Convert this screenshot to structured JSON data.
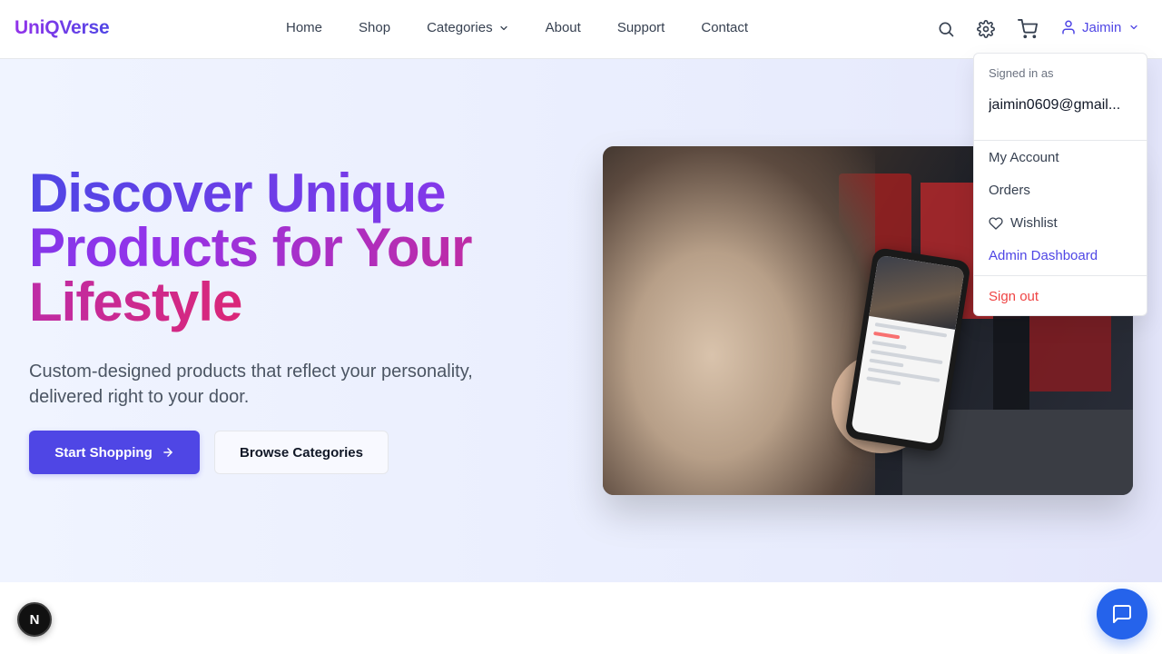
{
  "brand": {
    "logo_text": "UniQVerse"
  },
  "nav": {
    "links": [
      {
        "label": "Home"
      },
      {
        "label": "Shop"
      },
      {
        "label": "Categories",
        "has_dropdown": true
      },
      {
        "label": "About"
      },
      {
        "label": "Support"
      },
      {
        "label": "Contact"
      }
    ],
    "icons": [
      "search-icon",
      "settings-icon",
      "cart-icon"
    ],
    "user": {
      "name": "Jaimin",
      "icon": "user-icon"
    }
  },
  "hero": {
    "headline": "Discover Unique Products for Your Lifestyle",
    "subtitle": "Custom-designed products that reflect your personality, delivered right to your door.",
    "primary_button": "Start Shopping",
    "secondary_button": "Browse Categories"
  },
  "user_menu": {
    "signed_in_label": "Signed in as",
    "email": "jaimin0609@gmail...",
    "items": {
      "account": "My Account",
      "orders": "Orders",
      "wishlist": "Wishlist",
      "admin": "Admin Dashboard",
      "signout": "Sign out"
    }
  },
  "badges": {
    "next_badge": "N"
  },
  "colors": {
    "accent": "#4f46e5",
    "danger": "#ef4444",
    "chat": "#2563eb"
  }
}
